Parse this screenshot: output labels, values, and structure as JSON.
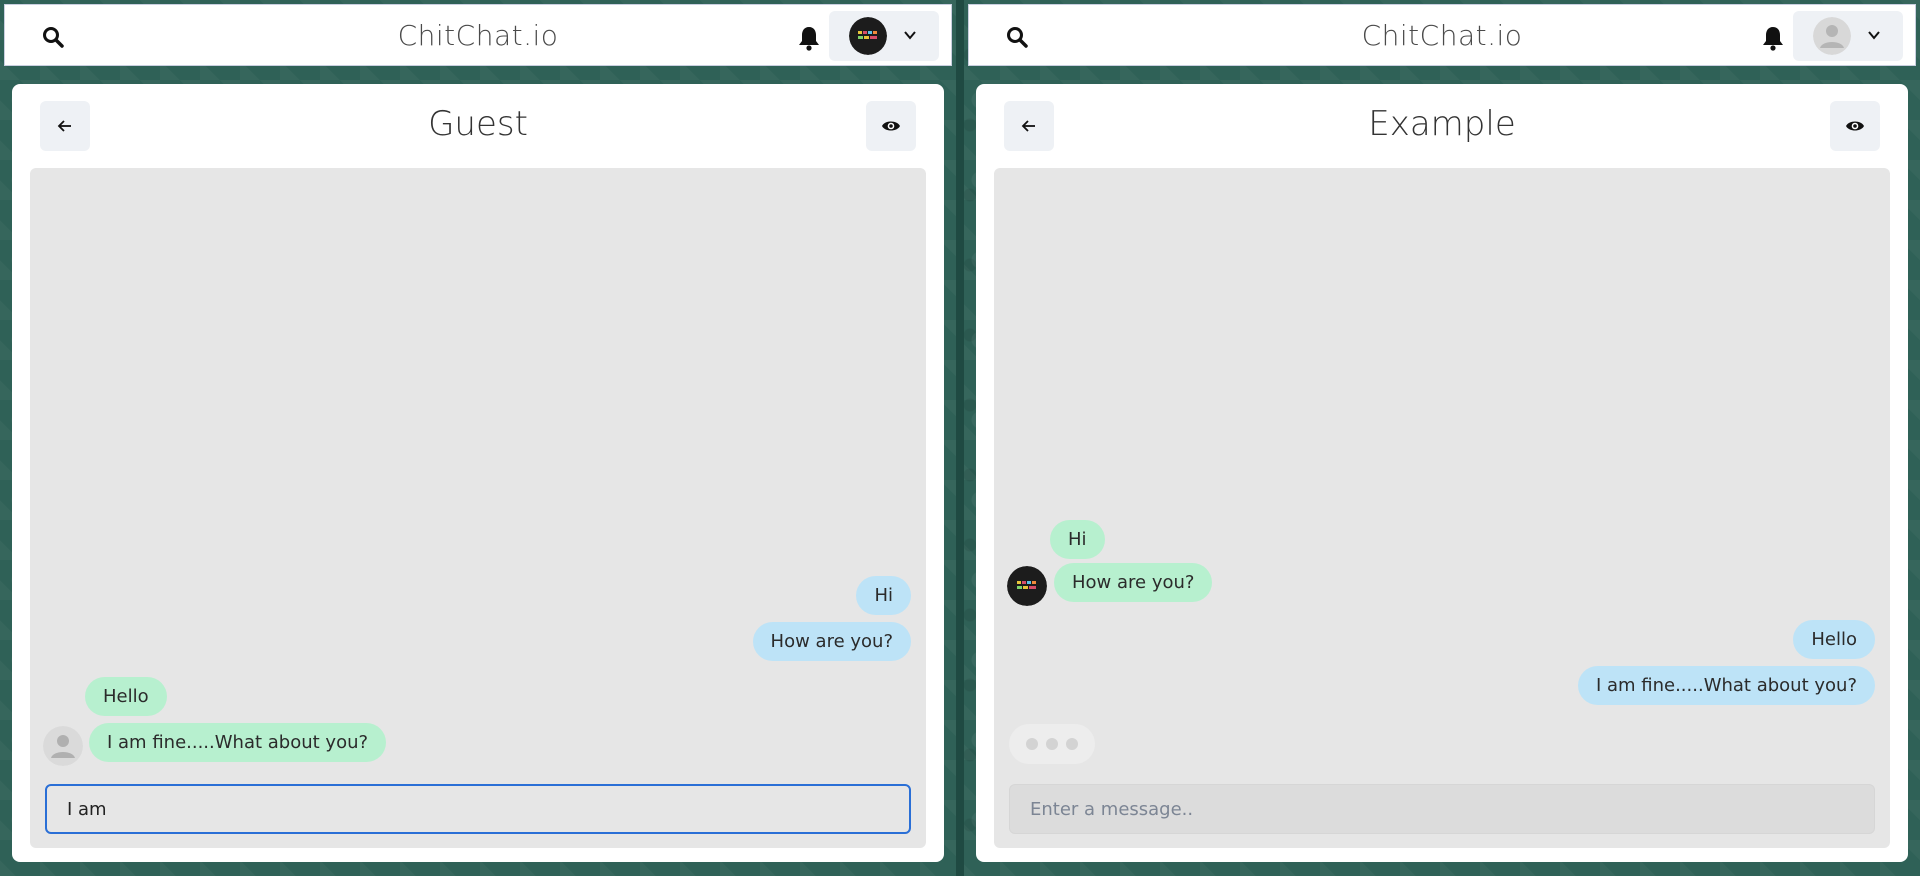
{
  "app": {
    "brand": "ChitChat.io"
  },
  "left": {
    "chat_title": "Guest",
    "messages_sent": [
      "Hi",
      "How are you?"
    ],
    "messages_received": [
      "Hello",
      "I am fine.....What about you?"
    ],
    "input_value": "I am",
    "user_avatar": "brand-logo-avatar"
  },
  "right": {
    "chat_title": "Example",
    "messages_received": [
      "Hi",
      "How are you?"
    ],
    "messages_sent": [
      "Hello",
      "I am fine.....What about you?"
    ],
    "input_placeholder": "Enter a message..",
    "user_avatar": "default-user-avatar",
    "typing_indicator": true
  },
  "icons": [
    "search-icon",
    "bell-icon",
    "chevron-down-icon",
    "back-arrow-icon",
    "eye-icon",
    "user-avatar-icon"
  ],
  "colors": {
    "wallpaper": "#2f6157",
    "bubble_sent_blue": "#bde3f7",
    "bubble_received_green": "#b7f0cf",
    "focus_border": "#2a6fd6"
  }
}
